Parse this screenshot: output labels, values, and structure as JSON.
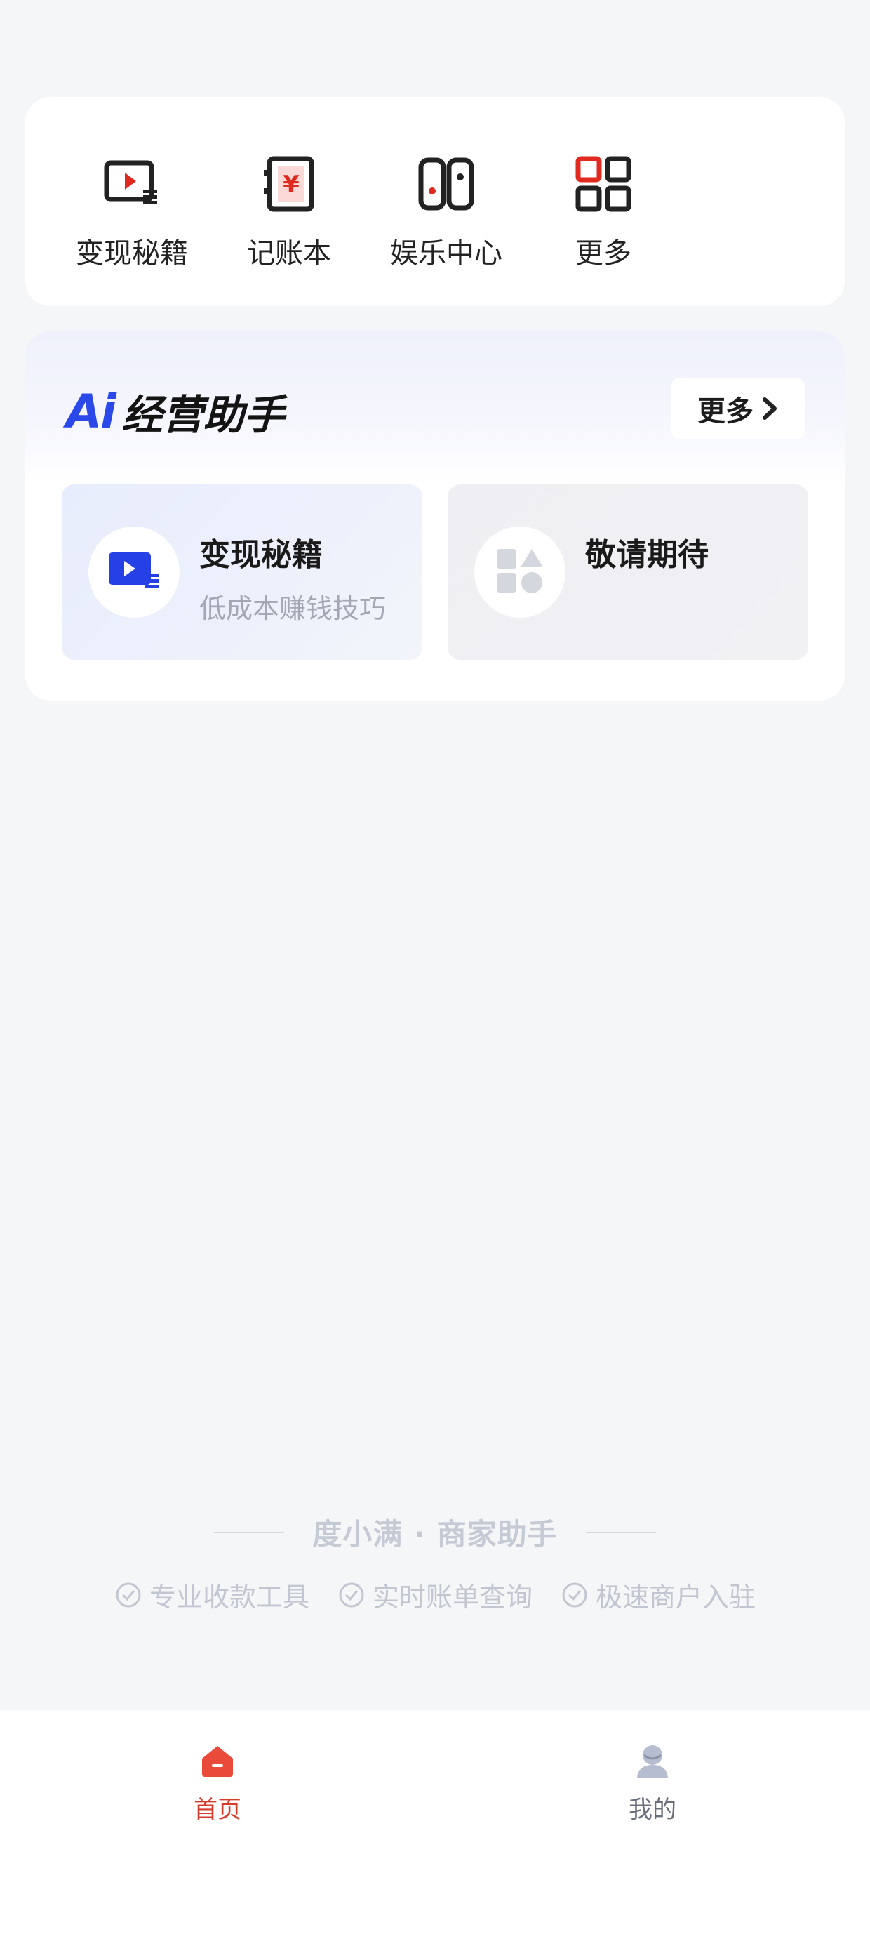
{
  "quick_actions": [
    {
      "label": "变现秘籍",
      "icon": "video-card-icon"
    },
    {
      "label": "记账本",
      "icon": "ledger-book-icon"
    },
    {
      "label": "娱乐中心",
      "icon": "game-controller-icon"
    },
    {
      "label": "更多",
      "icon": "grid-more-icon"
    }
  ],
  "ai_assistant": {
    "logo": "Ai",
    "title": "经营助手",
    "more_label": "更多",
    "features": [
      {
        "title": "变现秘籍",
        "subtitle": "低成本赚钱技巧",
        "icon": "video-play-icon"
      },
      {
        "title": "敬请期待",
        "subtitle": "",
        "icon": "shapes-icon"
      }
    ]
  },
  "brand": {
    "text": "度小满 · 商家助手",
    "features": [
      "专业收款工具",
      "实时账单查询",
      "极速商户入驻"
    ]
  },
  "bottom_nav": {
    "items": [
      {
        "label": "首页",
        "active": true
      },
      {
        "label": "我的",
        "active": false
      }
    ]
  },
  "colors": {
    "accent_red": "#d63a2a",
    "ai_blue": "#2a49e8",
    "background": "#f5f6f8"
  }
}
